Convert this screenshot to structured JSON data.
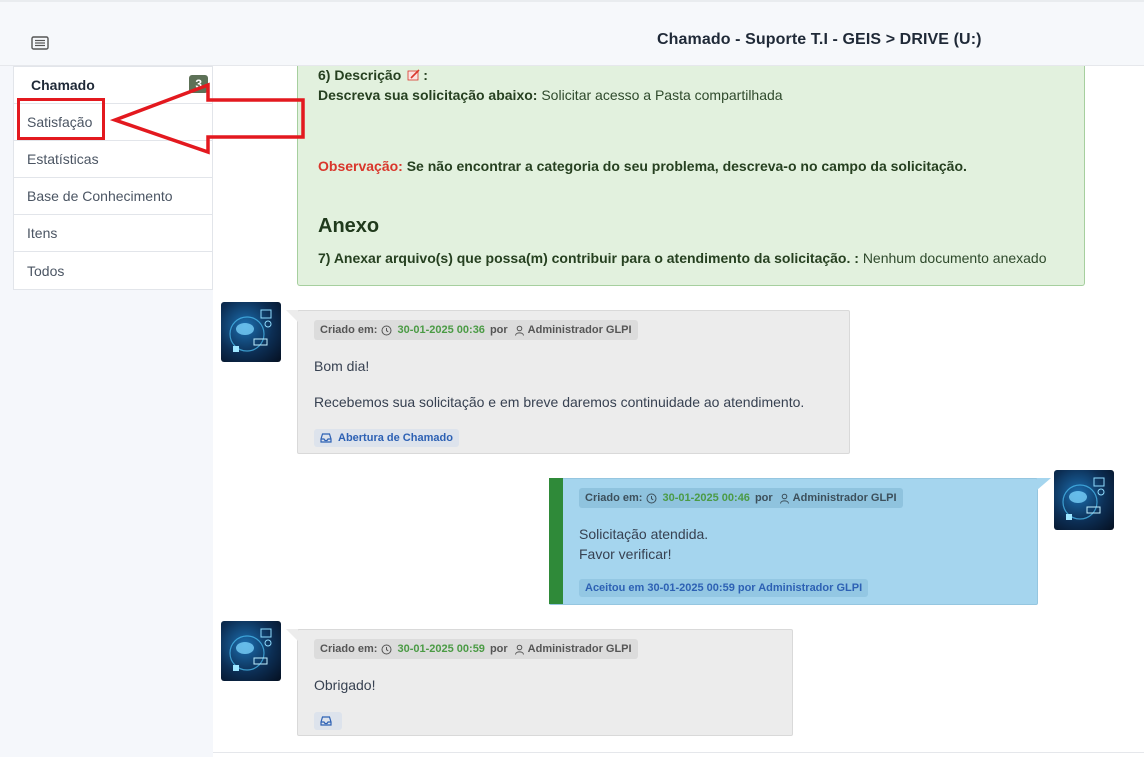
{
  "header": {
    "title": "Chamado - Suporte T.I - GEIS > DRIVE (U:)"
  },
  "sidebar": {
    "items": [
      {
        "label": "Chamado",
        "badge": "3"
      },
      {
        "label": "Satisfação"
      },
      {
        "label": "Estatísticas"
      },
      {
        "label": "Base de Conhecimento"
      },
      {
        "label": "Itens"
      },
      {
        "label": "Todos"
      }
    ]
  },
  "description": {
    "section_label": "6) Descrição",
    "section_colon": ":",
    "request_label": "Descreva sua solicitação abaixo:",
    "request_value": "Solicitar acesso a Pasta compartilhada",
    "note_label": "Observação:",
    "note_text": "Se não encontrar a categoria do seu problema, descreva-o no campo da solicitação.",
    "attachment_heading": "Anexo",
    "attachment_label": "7) Anexar arquivo(s) que possa(m) contribuir para o atendimento da solicitação. :",
    "attachment_value": "Nenhum documento anexado"
  },
  "timeline": {
    "items": [
      {
        "created_label": "Criado em:",
        "date": "30-01-2025 00:36",
        "by": "por",
        "author": "Administrador GLPI",
        "lines": [
          "Bom dia!",
          "Recebemos sua solicitação e em breve daremos continuidade ao atendimento."
        ],
        "source": "Abertura de Chamado"
      },
      {
        "created_label": "Criado em:",
        "date": "30-01-2025 00:46",
        "by": "por",
        "author": "Administrador GLPI",
        "lines": [
          "Solicitação atendida.",
          "Favor verificar!"
        ],
        "accepted": "Aceitou em 30-01-2025 00:59 por Administrador GLPI"
      },
      {
        "created_label": "Criado em:",
        "date": "30-01-2025 00:59",
        "by": "por",
        "author": "Administrador GLPI",
        "lines": [
          "Obrigado!"
        ],
        "source": ""
      }
    ]
  },
  "colors": {
    "description_bg": "#e2f1de",
    "solution_bg": "#a5d5ee",
    "solution_bar": "#2f8a39",
    "date_green": "#4b9b45",
    "highlight_red": "#e3191f",
    "link_blue": "#2d61b4"
  },
  "icons": {
    "toggle": "sidebar-toggle-icon",
    "clock": "clock-icon",
    "user": "user-icon",
    "source": "inbox-icon",
    "edit": "edit-icon"
  }
}
